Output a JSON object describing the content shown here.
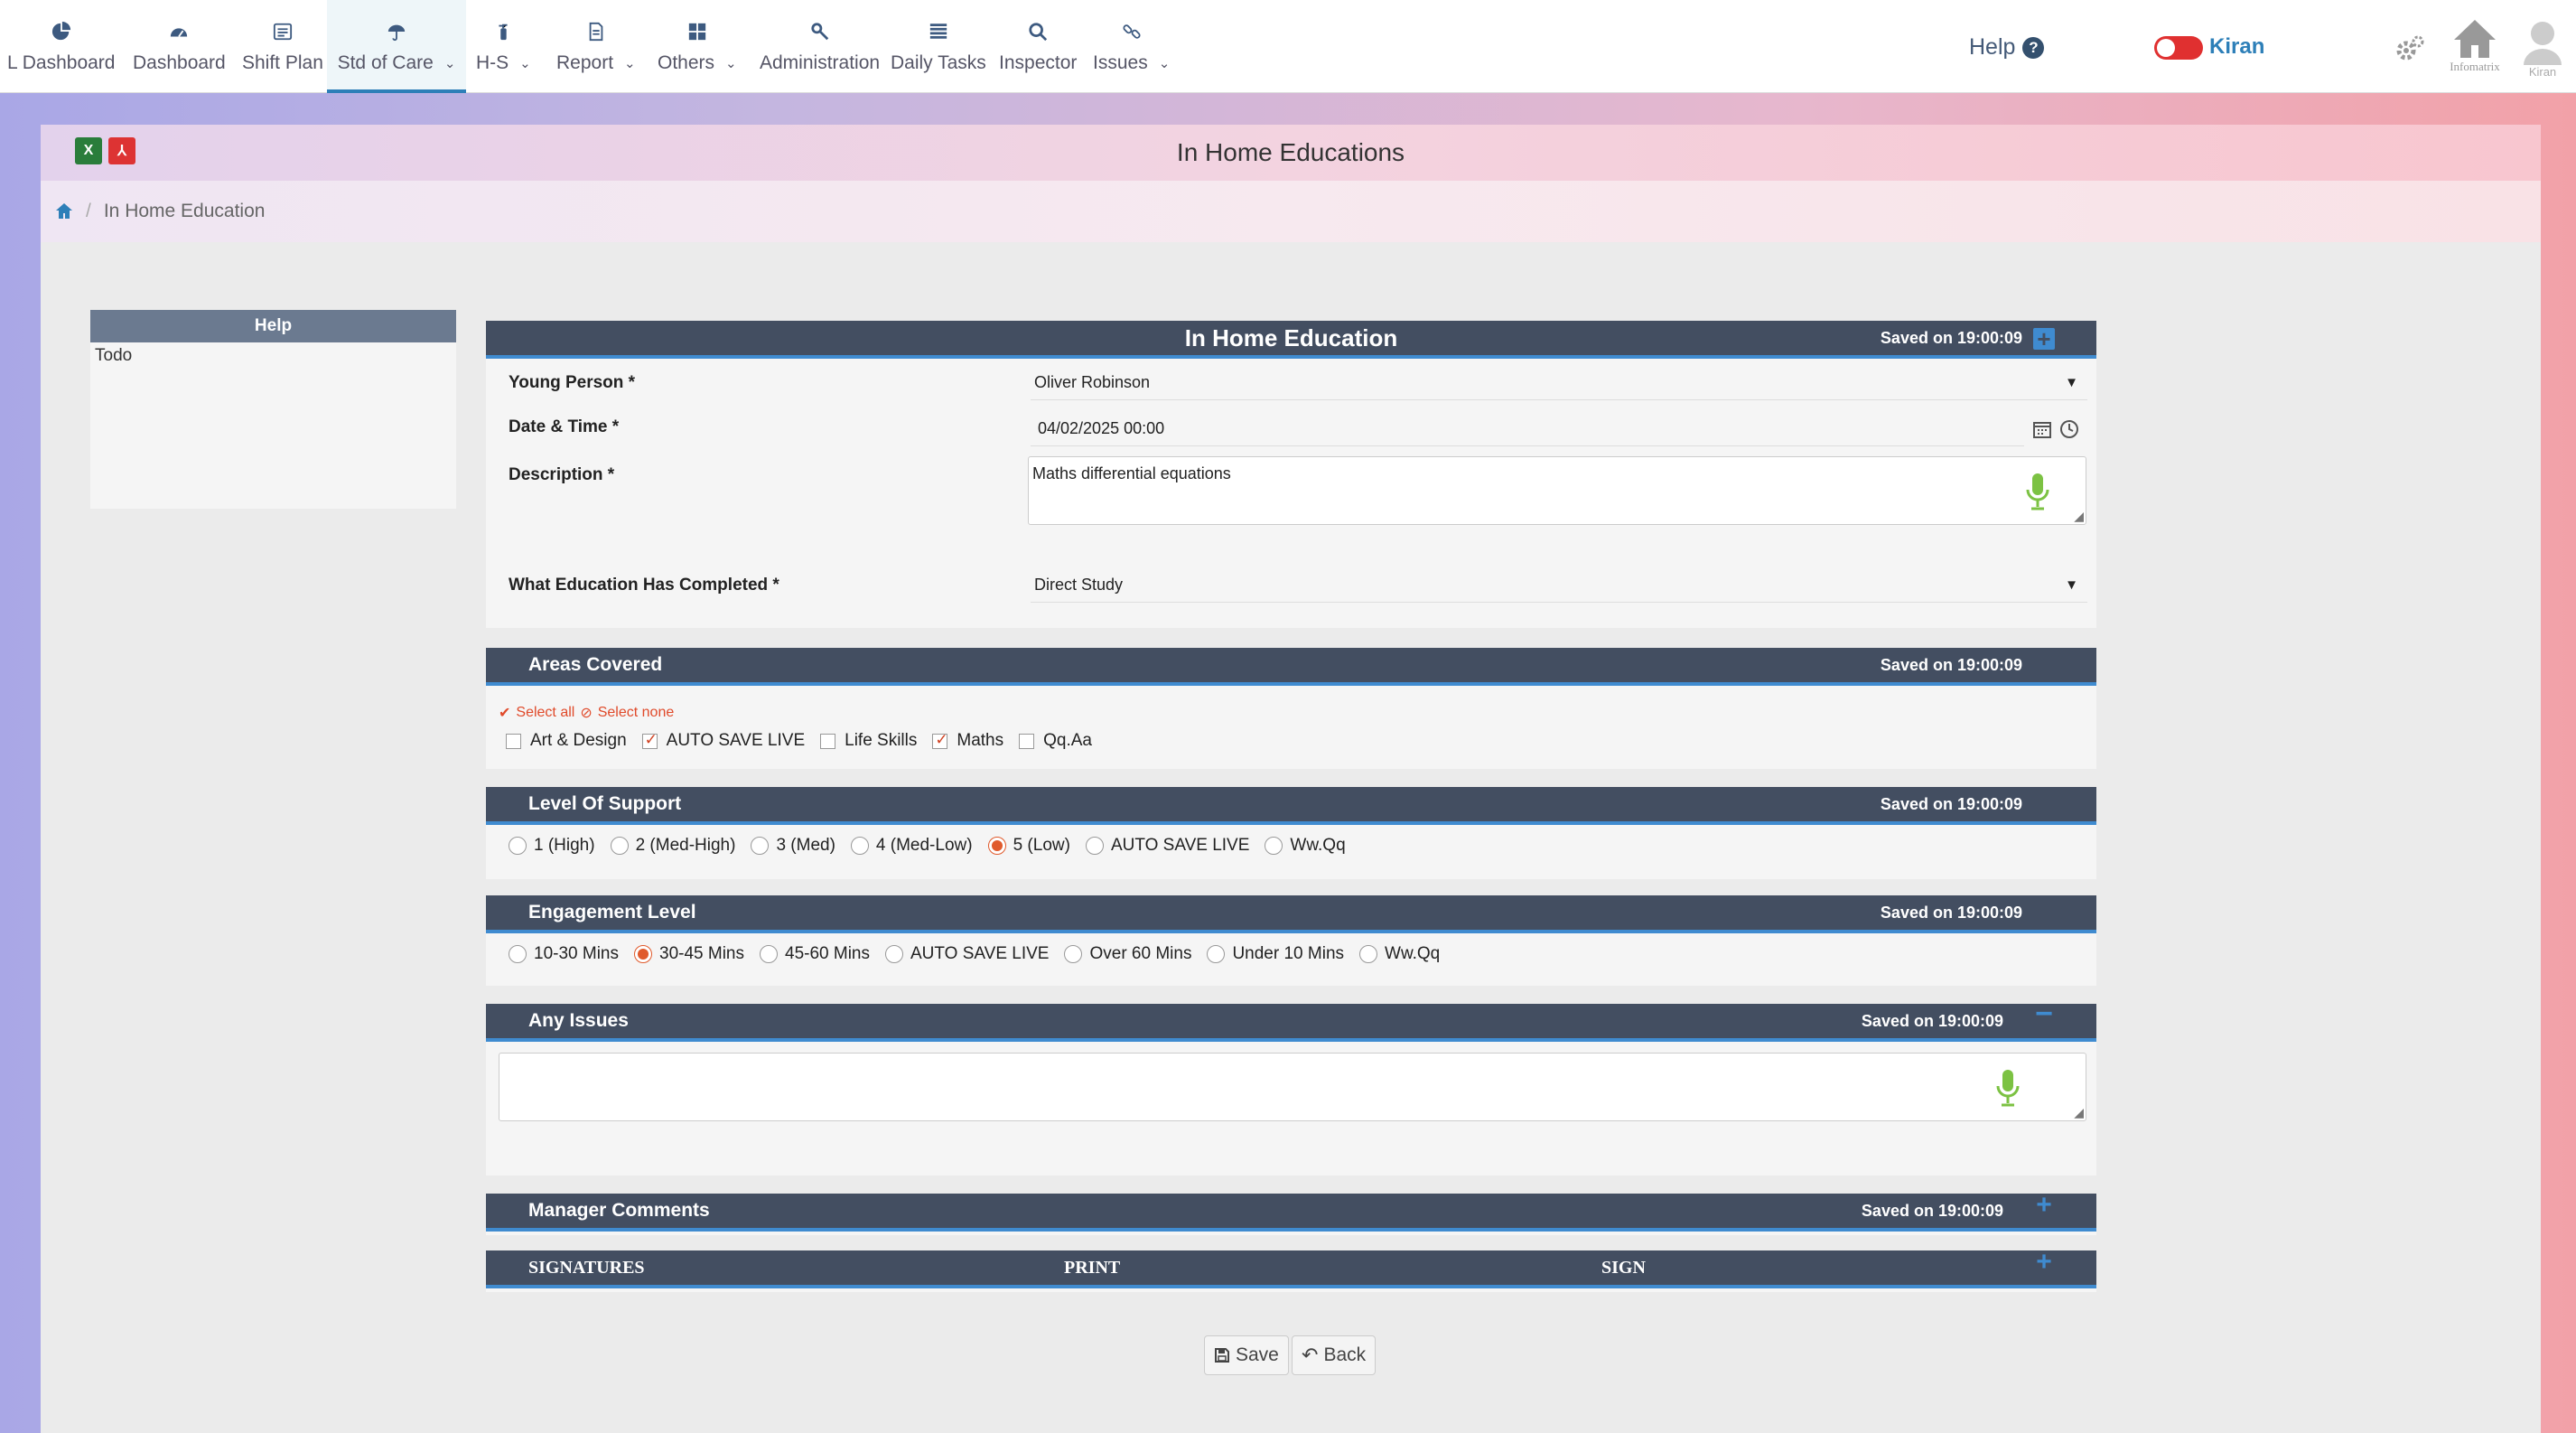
{
  "nav": {
    "items": [
      {
        "label": "L Dashboard",
        "icon": "pie-chart-icon"
      },
      {
        "label": "Dashboard",
        "icon": "speedometer-icon"
      },
      {
        "label": "Shift Plan",
        "icon": "calendar-list-icon"
      },
      {
        "label": "Std of Care",
        "icon": "umbrella-icon",
        "active": true
      },
      {
        "label": "H-S",
        "icon": "fire-extinguisher-icon"
      },
      {
        "label": "Report",
        "icon": "document-icon"
      },
      {
        "label": "Others",
        "icon": "grid-icon"
      },
      {
        "label": "Administration",
        "icon": "wrench-icon"
      },
      {
        "label": "Daily Tasks",
        "icon": "tasks-list-icon"
      },
      {
        "label": "Inspector",
        "icon": "magnifier-icon"
      },
      {
        "label": "Issues",
        "icon": "link-icon"
      }
    ],
    "help": "Help",
    "user": "Kiran",
    "home_label": "Infomatrix",
    "avatar_label": "Kiran"
  },
  "page": {
    "title": "In Home Educations",
    "breadcrumb": "In Home Education"
  },
  "help_panel": {
    "title": "Help",
    "body": "Todo"
  },
  "form": {
    "title": "In Home Education",
    "saved": "Saved on 19:00:09",
    "young_person_label": "Young Person *",
    "young_person": "Oliver Robinson",
    "datetime_label": "Date & Time *",
    "datetime": "04/02/2025 00:00",
    "description_label": "Description *",
    "description": "Maths differential equations",
    "education_label": "What Education Has Completed *",
    "education": "Direct Study"
  },
  "areas": {
    "title": "Areas Covered",
    "saved": "Saved on 19:00:09",
    "select_all": "Select all",
    "select_none": "Select none",
    "options": [
      {
        "label": "Art & Design",
        "checked": false
      },
      {
        "label": "AUTO SAVE LIVE",
        "checked": true
      },
      {
        "label": "Life Skills",
        "checked": false
      },
      {
        "label": "Maths",
        "checked": true
      },
      {
        "label": "Qq.Aa",
        "checked": false
      }
    ]
  },
  "support": {
    "title": "Level Of Support",
    "saved": "Saved on 19:00:09",
    "options": [
      {
        "label": "1 (High)",
        "checked": false
      },
      {
        "label": "2 (Med-High)",
        "checked": false
      },
      {
        "label": "3 (Med)",
        "checked": false
      },
      {
        "label": "4 (Med-Low)",
        "checked": false
      },
      {
        "label": "5 (Low)",
        "checked": true
      },
      {
        "label": "AUTO SAVE LIVE",
        "checked": false
      },
      {
        "label": "Ww.Qq",
        "checked": false
      }
    ]
  },
  "engagement": {
    "title": "Engagement Level",
    "saved": "Saved on 19:00:09",
    "options": [
      {
        "label": "10-30 Mins",
        "checked": false
      },
      {
        "label": "30-45 Mins",
        "checked": true
      },
      {
        "label": "45-60 Mins",
        "checked": false
      },
      {
        "label": "AUTO SAVE LIVE",
        "checked": false
      },
      {
        "label": "Over 60 Mins",
        "checked": false
      },
      {
        "label": "Under 10 Mins",
        "checked": false
      },
      {
        "label": "Ww.Qq",
        "checked": false
      }
    ]
  },
  "issues": {
    "title": "Any Issues",
    "saved": "Saved on 19:00:09",
    "value": ""
  },
  "manager": {
    "title": "Manager Comments",
    "saved": "Saved on 19:00:09"
  },
  "signatures": {
    "col1": "SIGNATURES",
    "col2": "PRINT",
    "col3": "SIGN"
  },
  "buttons": {
    "save": "Save",
    "back": "Back"
  },
  "colors": {
    "accent": "#3f8bd0",
    "header_bar": "#434e61",
    "radio_on": "#e05a2c",
    "mic": "#7cc243"
  }
}
